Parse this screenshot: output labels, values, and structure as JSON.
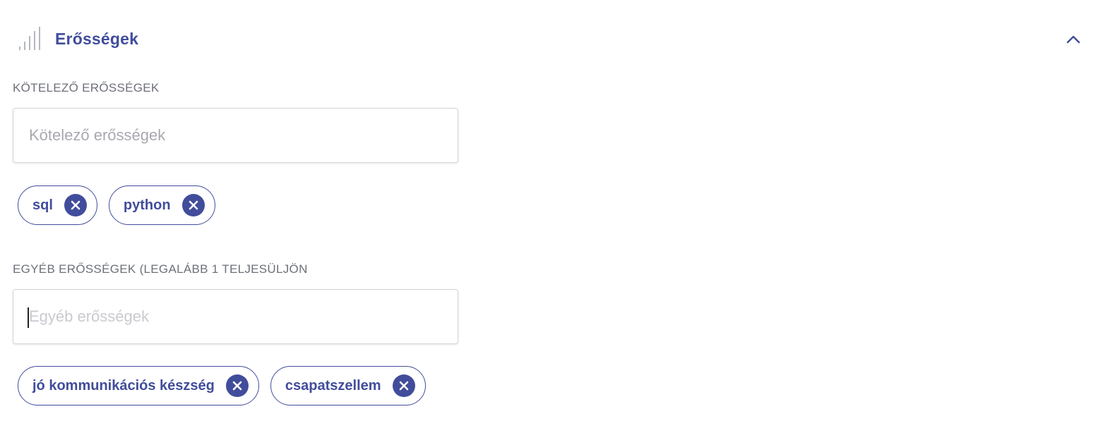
{
  "section": {
    "title": "Erősségek",
    "icon": "signal-strength-icon",
    "collapse_icon": "chevron-up-icon"
  },
  "required": {
    "label": "KÖTELEZŐ ERŐSSÉGEK",
    "placeholder": "Kötelező erősségek",
    "value": "",
    "tags": [
      "sql",
      "python"
    ]
  },
  "other": {
    "label": "EGYÉB ERŐSSÉGEK (LEGALÁBB 1 TELJESÜLJÖN",
    "placeholder": "Egyéb erősségek",
    "value": "",
    "tags": [
      "jó kommunikációs készség",
      "csapatszellem"
    ]
  },
  "colors": {
    "accent": "#414d9b",
    "label": "#6e7079",
    "icon_gray": "#b5b7c0"
  }
}
